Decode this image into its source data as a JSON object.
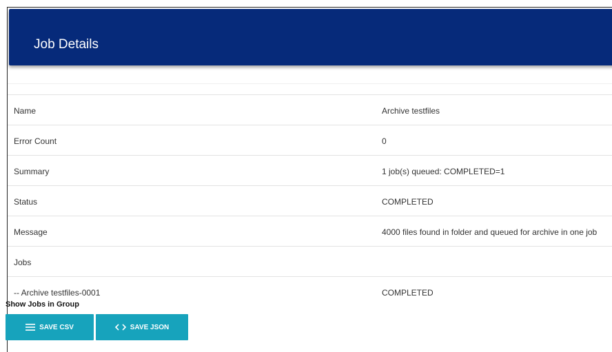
{
  "header": {
    "title": "Job Details"
  },
  "details": [
    {
      "key": "Name",
      "value": "Archive testfiles"
    },
    {
      "key": "Error Count",
      "value": "0"
    },
    {
      "key": "Summary",
      "value": "1 job(s) queued: COMPLETED=1"
    },
    {
      "key": "Status",
      "value": "COMPLETED"
    },
    {
      "key": "Message",
      "value": "4000 files found in folder and queued for archive in one job"
    },
    {
      "key": "Jobs",
      "value": ""
    },
    {
      "key": "-- Archive testfiles-0001",
      "value": "COMPLETED"
    }
  ],
  "group": {
    "label": "Show Jobs in Group"
  },
  "actions": {
    "save_csv": "SAVE CSV",
    "save_json": "SAVE JSON",
    "csv_icon": "list-icon",
    "json_icon": "code-icon"
  },
  "colors": {
    "header": "#062a7a",
    "button": "#17a3bc"
  }
}
